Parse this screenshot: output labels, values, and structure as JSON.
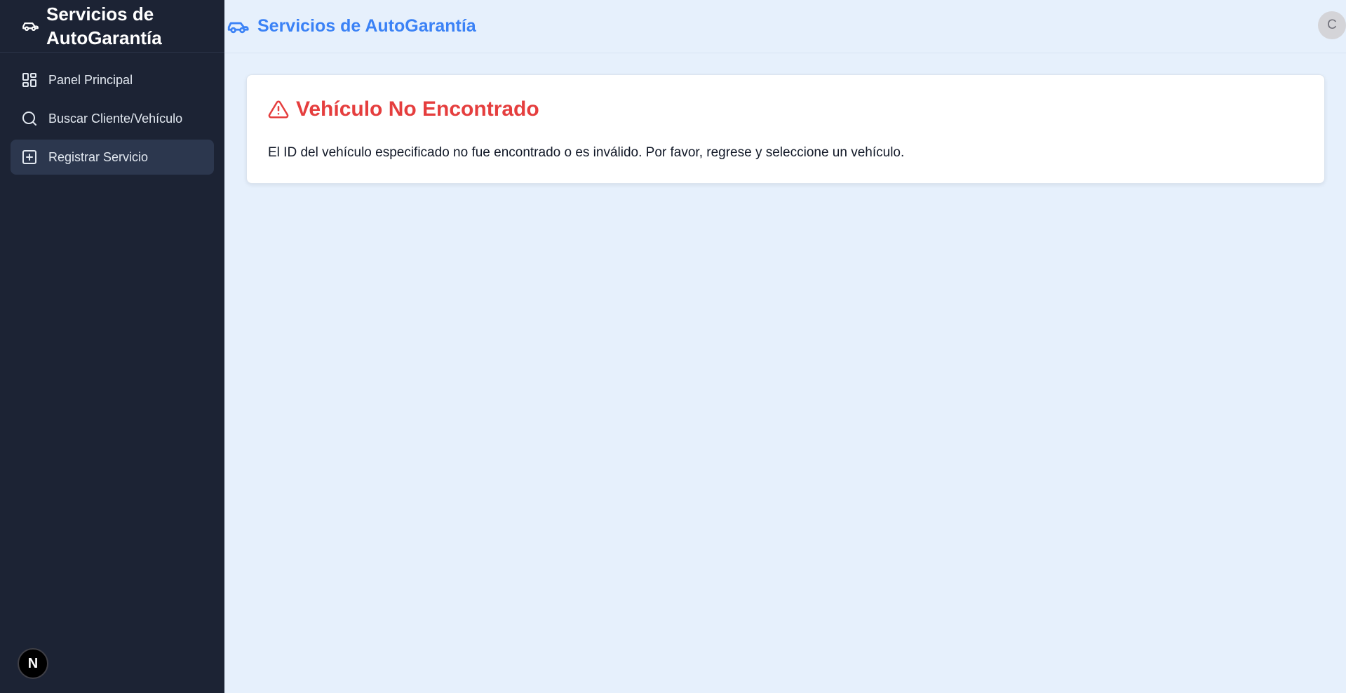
{
  "app": {
    "brand_title": "Servicios de AutoGarantía"
  },
  "sidebar": {
    "items": [
      {
        "label": "Panel Principal",
        "icon": "dashboard-icon",
        "active": false
      },
      {
        "label": "Buscar Cliente/Vehículo",
        "icon": "search-icon",
        "active": false
      },
      {
        "label": "Registrar Servicio",
        "icon": "plus-square-icon",
        "active": true
      }
    ],
    "bottom_badge": "N"
  },
  "header": {
    "title": "Servicios de AutoGarantía",
    "avatar_initial": "C"
  },
  "error_card": {
    "title": "Vehículo No Encontrado",
    "message": "El ID del vehículo especificado no fue encontrado o es inválido. Por favor, regrese y seleccione un vehículo."
  },
  "colors": {
    "sidebar_bg": "#1c2334",
    "main_bg": "#e6f0fc",
    "accent": "#3b82f6",
    "error": "#e53e3e"
  }
}
